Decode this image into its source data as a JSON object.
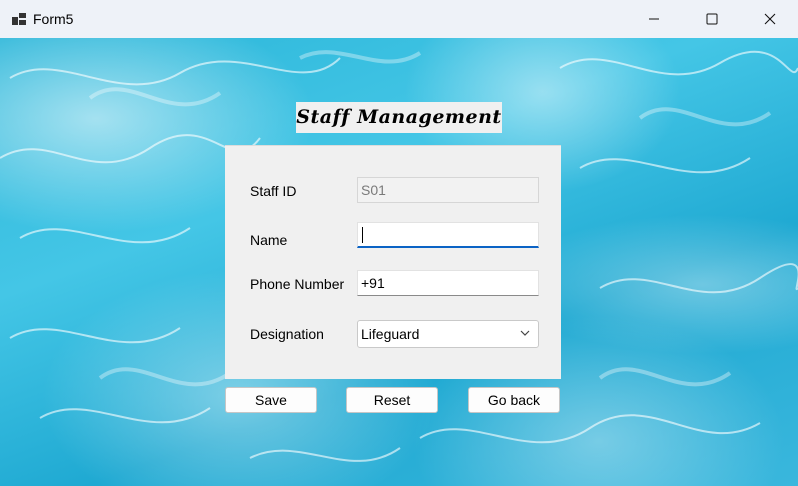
{
  "window": {
    "title": "Form5"
  },
  "heading": "Staff Management",
  "form": {
    "staff_id": {
      "label": "Staff ID",
      "value": "S01"
    },
    "name": {
      "label": "Name",
      "value": ""
    },
    "phone": {
      "label": "Phone Number",
      "value": "+91"
    },
    "designation": {
      "label": "Designation",
      "selected": "Lifeguard"
    }
  },
  "buttons": {
    "save": "Save",
    "reset": "Reset",
    "go_back": "Go back"
  },
  "icons": {
    "app": "app-icon",
    "minimize": "minimize-icon",
    "maximize": "maximize-icon",
    "close": "close-icon",
    "dropdown": "chevron-down-icon"
  },
  "colors": {
    "title_bar": "#eef2f8",
    "water": "#2bb6d9",
    "panel": "#f0f0f0",
    "focus_accent": "#0b63c5"
  }
}
